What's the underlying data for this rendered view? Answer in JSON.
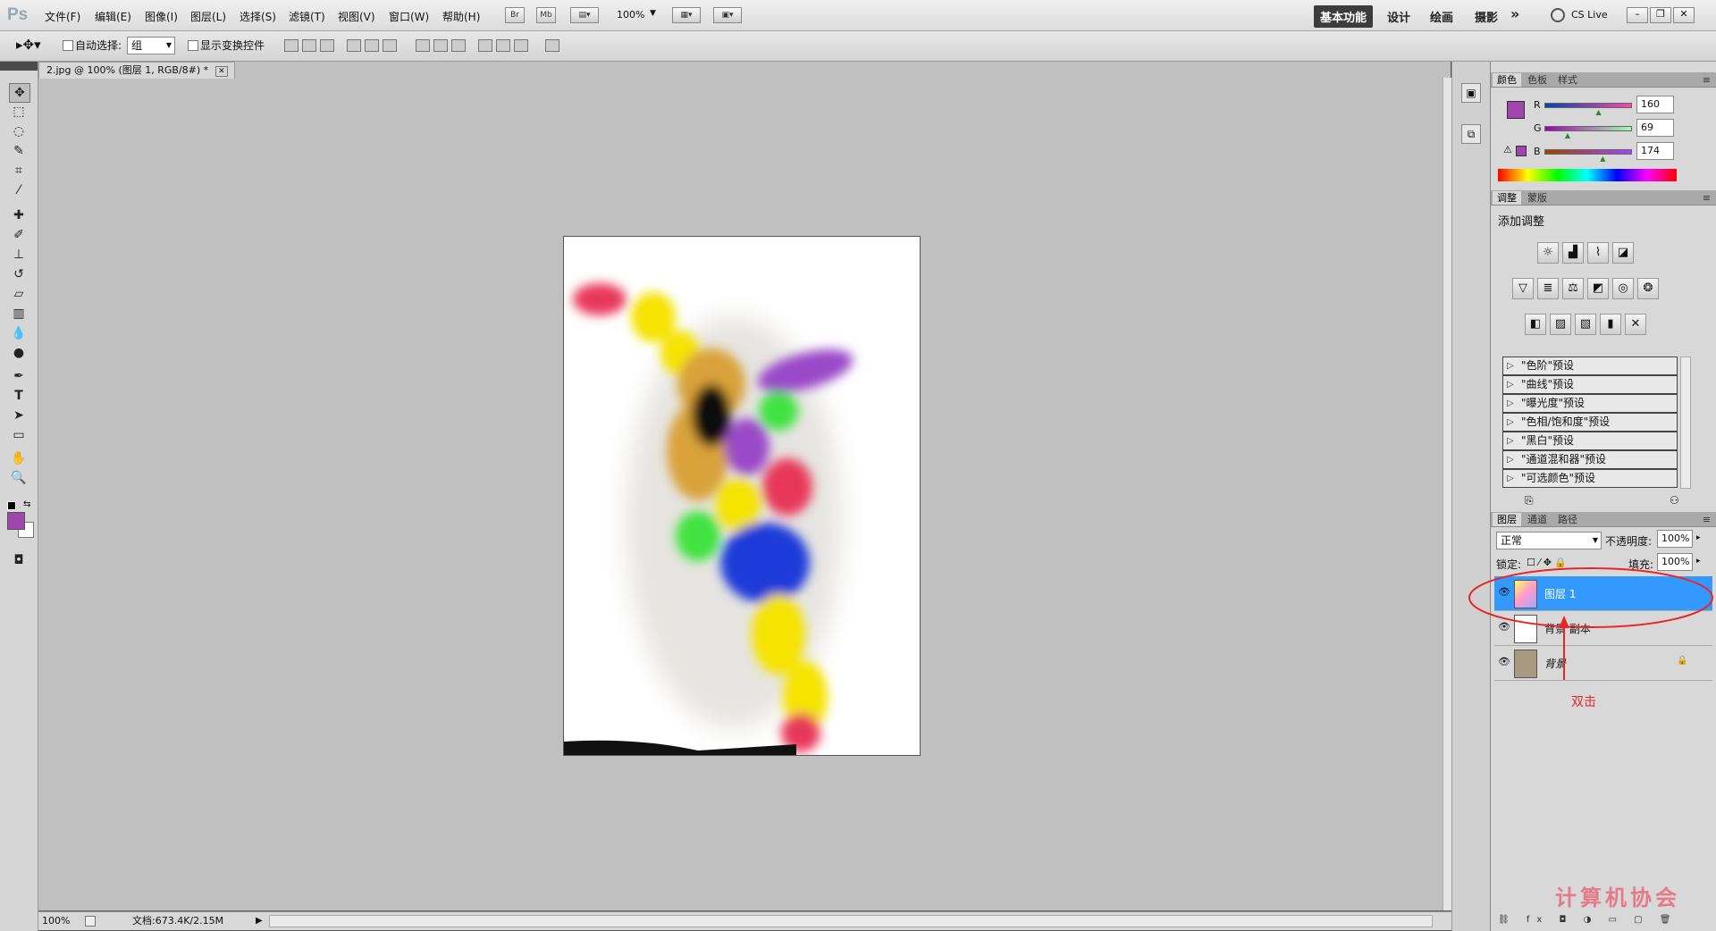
{
  "app": {
    "logo": "Ps"
  },
  "menus": [
    "文件(F)",
    "编辑(E)",
    "图像(I)",
    "图层(L)",
    "选择(S)",
    "滤镜(T)",
    "视图(V)",
    "窗口(W)",
    "帮助(H)"
  ],
  "menubar": {
    "br": "Br",
    "mb": "Mb",
    "zoom": "100%",
    "workspaces": [
      "基本功能",
      "设计",
      "绘画",
      "摄影"
    ],
    "more": "»",
    "cslive": "CS Live"
  },
  "options": {
    "auto_select_label": "自动选择:",
    "auto_select_value": "组",
    "show_transform_label": "显示变换控件"
  },
  "document": {
    "tab": "2.jpg @ 100% (图层 1, RGB/8#) *",
    "zoom": "100%",
    "docinfo": "文档:673.4K/2.15M"
  },
  "colors": {
    "foreground": "#a045ae",
    "accent": "#3399ff",
    "annotation": "#e8262a"
  },
  "color_panel": {
    "tabs": [
      "颜色",
      "色板",
      "样式"
    ],
    "r_label": "R",
    "g_label": "G",
    "b_label": "B",
    "r": "160",
    "g": "69",
    "b": "174",
    "r_level": 0.63,
    "g_level": 0.27,
    "b_level": 0.68
  },
  "adjust_panel": {
    "tabs": [
      "调整",
      "蒙版"
    ],
    "title": "添加调整",
    "presets": [
      "\"色阶\"预设",
      "\"曲线\"预设",
      "\"曝光度\"预设",
      "\"色相/饱和度\"预设",
      "\"黑白\"预设",
      "\"通道混和器\"预设",
      "\"可选颜色\"预设"
    ]
  },
  "layers_panel": {
    "tabs": [
      "图层",
      "通道",
      "路径"
    ],
    "blend_mode": "正常",
    "opacity_label": "不透明度:",
    "opacity": "100%",
    "lock_label": "锁定:",
    "fill_label": "填充:",
    "fill": "100%",
    "layers": [
      "图层 1",
      "背景 副本",
      "背景"
    ]
  },
  "annotation": {
    "text": "双击"
  },
  "watermark": "计算机协会"
}
